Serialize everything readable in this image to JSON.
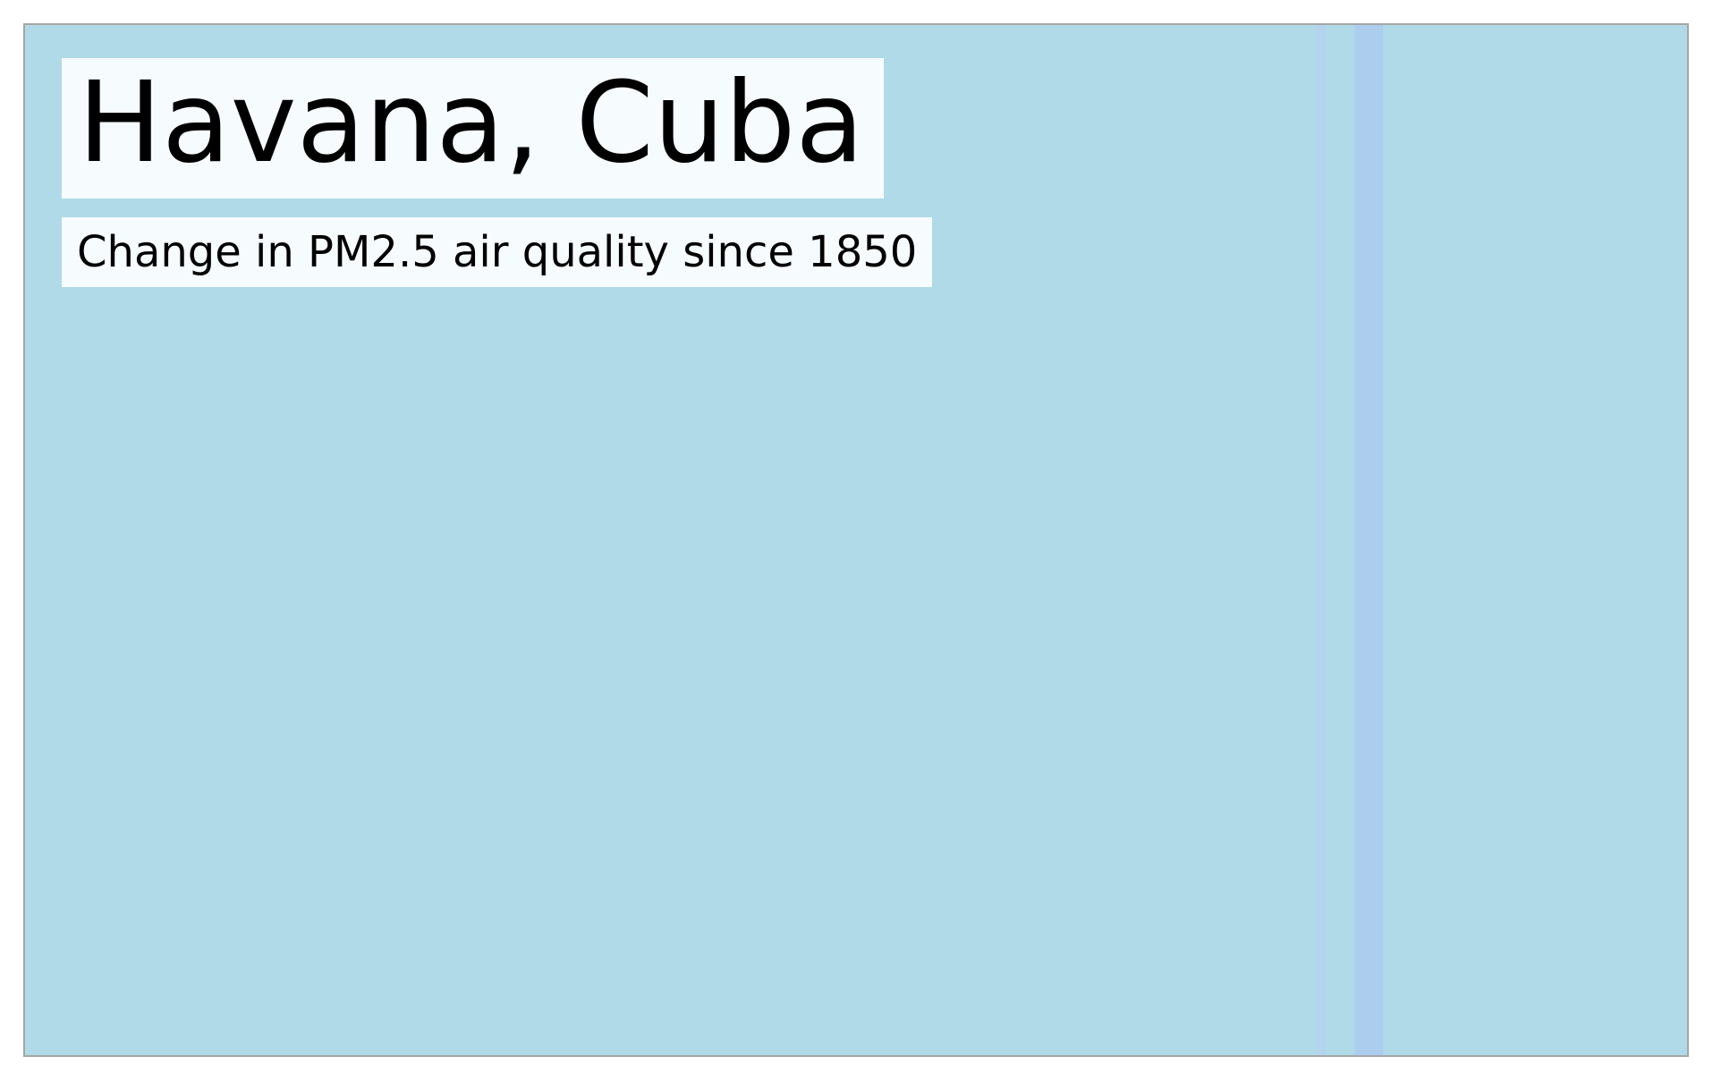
{
  "chart_data": {
    "type": "heatmap",
    "title": "Havana, Cuba",
    "subtitle": "Change in PM2.5 air quality since 1850",
    "xlabel": "",
    "ylabel": "",
    "grid": false,
    "legend": "none",
    "default_color": "#b0dae8",
    "stripes": [
      {
        "start": 0.0,
        "end": 0.777,
        "color": "#b0dae8"
      },
      {
        "start": 0.777,
        "end": 0.7825,
        "color": "#b3d3ef"
      },
      {
        "start": 0.7825,
        "end": 0.8,
        "color": "#b0dae8"
      },
      {
        "start": 0.8,
        "end": 0.817,
        "color": "#adcdee"
      },
      {
        "start": 0.817,
        "end": 1.0,
        "color": "#b0dae8"
      }
    ]
  },
  "colors": {
    "frame_border": "#a6a6a6",
    "label_background": "#ffffff",
    "text": "#000000"
  }
}
